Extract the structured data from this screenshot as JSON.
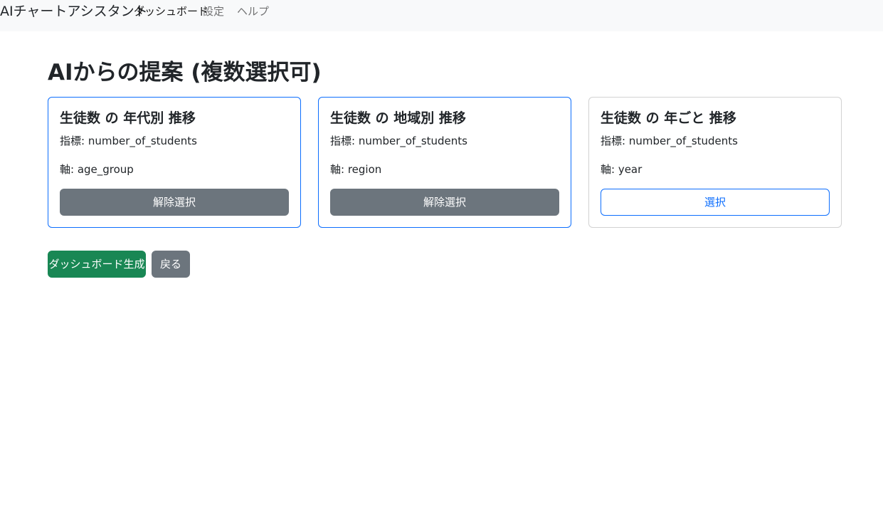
{
  "navbar": {
    "brand": "AIチャートアシスタント",
    "links": [
      {
        "label": "ダッシュボード"
      },
      {
        "label": "設定"
      },
      {
        "label": "ヘルプ"
      }
    ]
  },
  "main": {
    "title": "AIからの提案 (複数選択可)",
    "cards": [
      {
        "title": "生徒数 の 年代別 推移",
        "metric": "指標: number_of_students",
        "axis": "軸: age_group",
        "button_label": "解除選択",
        "selected": true
      },
      {
        "title": "生徒数 の 地域別 推移",
        "metric": "指標: number_of_students",
        "axis": "軸: region",
        "button_label": "解除選択",
        "selected": true
      },
      {
        "title": "生徒数 の 年ごと 推移",
        "metric": "指標: number_of_students",
        "axis": "軸: year",
        "button_label": "選択",
        "selected": false
      }
    ],
    "actions": {
      "generate_label": "ダッシュボード生成",
      "back_label": "戻る"
    }
  },
  "colors": {
    "primary": "#0d6efd",
    "secondary": "#6c757d",
    "success": "#198754",
    "navbar_bg": "#f8f9fa"
  }
}
